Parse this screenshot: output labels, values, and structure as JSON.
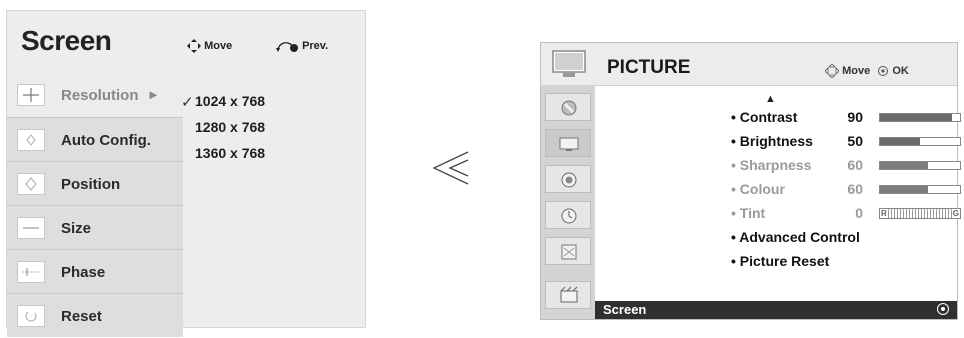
{
  "screen_menu": {
    "title": "Screen",
    "move_label": "Move",
    "prev_label": "Prev.",
    "items": [
      {
        "label": "Resolution",
        "icon": "resolution-icon"
      },
      {
        "label": "Auto Config.",
        "icon": "auto-config-icon"
      },
      {
        "label": "Position",
        "icon": "position-icon"
      },
      {
        "label": "Size",
        "icon": "size-icon"
      },
      {
        "label": "Phase",
        "icon": "phase-icon"
      },
      {
        "label": "Reset",
        "icon": "reset-icon"
      }
    ],
    "resolution_options": [
      "1024 x 768",
      "1280 x 768",
      "1360 x 768"
    ],
    "selected_resolution": "1024 x 768"
  },
  "separator_symbol": "much-less-than",
  "picture_menu": {
    "title": "PICTURE",
    "move_label": "Move",
    "ok_label": "OK",
    "side_icons": [
      "picture-mode-icon",
      "picture-icon",
      "audio-icon",
      "time-icon",
      "option-icon",
      "screen-icon"
    ],
    "rows": [
      {
        "label": "• Contrast",
        "value": "90",
        "level": 0.9
      },
      {
        "label": "• Brightness",
        "value": "50",
        "level": 0.5
      },
      {
        "label": "• Sharpness",
        "value": "60",
        "level": 0.6
      },
      {
        "label": "• Colour",
        "value": "60",
        "level": 0.6
      },
      {
        "label": "• Tint",
        "value": "0",
        "bar_left": "R",
        "bar_right": "G"
      },
      {
        "label": "• Advanced Control"
      },
      {
        "label": "• Picture Reset"
      }
    ],
    "bottom_item": "Screen"
  }
}
